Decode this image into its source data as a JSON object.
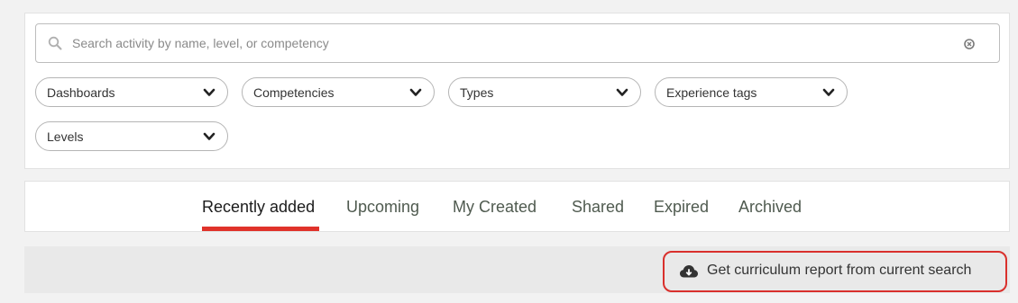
{
  "search": {
    "placeholder": "Search activity by name, level, or competency",
    "value": ""
  },
  "filters": [
    {
      "label": "Dashboards"
    },
    {
      "label": "Competencies"
    },
    {
      "label": "Types"
    },
    {
      "label": "Experience tags"
    },
    {
      "label": "Levels"
    }
  ],
  "tabs": [
    {
      "label": "Recently added",
      "active": true
    },
    {
      "label": "Upcoming"
    },
    {
      "label": "My Created"
    },
    {
      "label": "Shared"
    },
    {
      "label": "Expired"
    },
    {
      "label": "Archived"
    }
  ],
  "report": {
    "label": "Get curriculum report from current search",
    "icon": "cloud-download-icon"
  },
  "colors": {
    "accent": "#e0322a",
    "highlight_border": "#d9302c"
  }
}
